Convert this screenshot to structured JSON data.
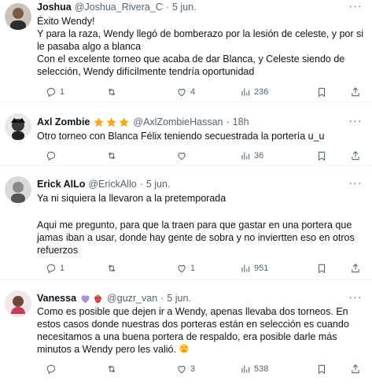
{
  "tweets": [
    {
      "name": "Joshua",
      "handle": "@Joshua_Rivera_C",
      "time": "5 jun.",
      "lines": [
        "Éxito Wendy!",
        "Y para la raza, Wendy llegó de bomberazo por la lesión de celeste, y por si le pasaba algo a blanca",
        "Con el excelente torneo que acaba de dar Blanca, y Celeste siendo de selección, Wendy difícilmente tendría oportunidad"
      ],
      "replies": "1",
      "retweets": "",
      "likes": "4",
      "views": "236"
    },
    {
      "name": "Axl Zombie",
      "handle": "@AxlZombieHassan",
      "time": "18h",
      "badges": [
        "star-icon",
        "star-icon",
        "star-icon"
      ],
      "lines": [
        "Otro torneo con Blanca Félix teniendo secuestrada la portería u_u"
      ],
      "replies": "",
      "retweets": "",
      "likes": "",
      "views": "36"
    },
    {
      "name": "Erick AlLo",
      "handle": "@ErickAllo",
      "time": "5 jun.",
      "lines": [
        "Ya ni siquiera la llevaron a la pretemporada",
        "Aqui me pregunto, para que la traen para que gastar en una portera que jamas iban a usar, donde hay gente de sobra y no inviertten eso en otros refuerzos"
      ],
      "replies": "1",
      "retweets": "",
      "likes": "1",
      "views": "951"
    },
    {
      "name": "Vanessa",
      "handle": "@guzr_van",
      "time": "5 jun.",
      "badges": [
        "purple-heart-icon",
        "strawberry-icon"
      ],
      "lines": [
        "Como es posible que dejen ir a Wendy, apenas llevaba dos torneos. En estos casos donde nuestras dos porteras están en selección es cuando necesitamos a una buena portera de respaldo, era posible darle más minutos a Wendy pero les valió."
      ],
      "end_emoji": "hand-over-mouth-emoji",
      "replies": "",
      "retweets": "",
      "likes": "3",
      "views": "538"
    }
  ],
  "colors": {
    "text": "#0f1419",
    "muted": "#536471",
    "divider": "#eff3f4",
    "star": "#f5a623",
    "purple_heart": "#aa8ed6",
    "strawberry": "#dd2e44",
    "emoji_yellow": "#ffcc4d"
  }
}
